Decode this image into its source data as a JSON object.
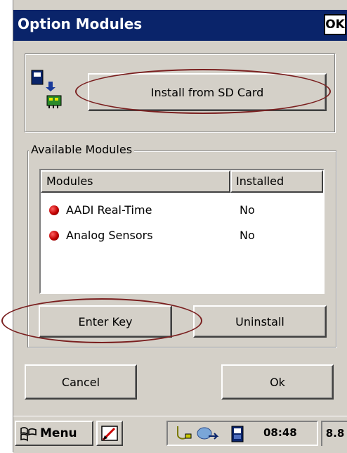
{
  "window": {
    "title": "Option Modules",
    "ok_label": "OK"
  },
  "install": {
    "button_label": "Install from SD Card",
    "icon": "sd-card-install-icon"
  },
  "available": {
    "group_label": "Available Modules",
    "columns": [
      "Modules",
      "Installed"
    ],
    "rows": [
      {
        "name": "AADI Real-Time",
        "installed": "No",
        "status_color": "#cc0000"
      },
      {
        "name": "Analog Sensors",
        "installed": "No",
        "status_color": "#cc0000"
      }
    ],
    "enter_key_label": "Enter Key",
    "uninstall_label": "Uninstall"
  },
  "footer": {
    "cancel_label": "Cancel",
    "ok_label": "Ok"
  },
  "taskbar": {
    "menu_label": "Menu",
    "time": "08:48",
    "battery": "8.8"
  },
  "colors": {
    "titlebar": "#0a246a",
    "face": "#d4d0c8",
    "annotation": "#7a1f1f"
  }
}
